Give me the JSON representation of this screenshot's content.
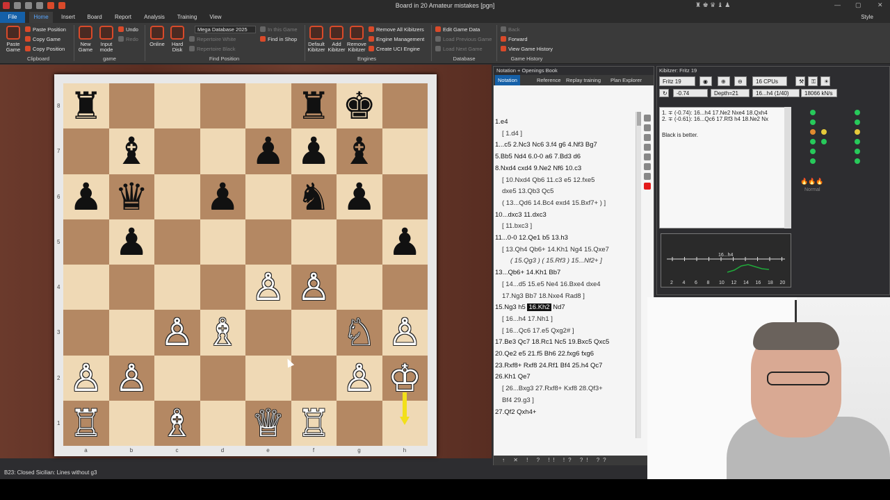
{
  "title": "Board in 20 Amateur mistakes [pgn]",
  "menu": {
    "file": "File",
    "home": "Home",
    "insert": "Insert",
    "board": "Board",
    "report": "Report",
    "analysis": "Analysis",
    "training": "Training",
    "view": "View",
    "style": "Style"
  },
  "ribbon": {
    "paste_game": "Paste Game",
    "paste_position": "Paste Position",
    "copy_game": "Copy Game",
    "copy_position": "Copy Position",
    "new_game": "New Game",
    "input_mode": "Input mode",
    "undo": "Undo",
    "redo": "Redo",
    "online": "Online",
    "hard_disk": "Hard Disk",
    "database": "Mega Database 2025",
    "in_this_game": "In this Game",
    "repertoire_white": "Repertoire White",
    "repertoire_black": "Repertoire Black",
    "find_in_shop": "Find in Shop",
    "default_kibitzer": "Default Kibitzer",
    "add_kibitzer": "Add Kibitzer",
    "remove_kibitzer": "Remove Kibitzer",
    "remove_all_kibitzers": "Remove All Kibitzers",
    "engine_management": "Engine Management",
    "create_uci_engine": "Create UCI Engine",
    "edit_game_data": "Edit Game Data",
    "load_previous_game": "Load Previous Game",
    "load_next_game": "Load Next Game",
    "back": "Back",
    "forward": "Forward",
    "view_game_history": "View Game History",
    "groups": {
      "clipboard": "Clipboard",
      "game": "game",
      "find_position": "Find Position",
      "engines": "Engines",
      "database": "Database",
      "game_history": "Game History"
    }
  },
  "board": {
    "ranks": [
      "8",
      "7",
      "6",
      "5",
      "4",
      "3",
      "2",
      "1"
    ],
    "files": [
      "a",
      "b",
      "c",
      "d",
      "e",
      "f",
      "g",
      "h"
    ],
    "pieces": [
      {
        "sq": "a8",
        "g": "♜",
        "c": "b"
      },
      {
        "sq": "f8",
        "g": "♜",
        "c": "b"
      },
      {
        "sq": "g8",
        "g": "♚",
        "c": "b"
      },
      {
        "sq": "b7",
        "g": "♝",
        "c": "b"
      },
      {
        "sq": "e7",
        "g": "♟",
        "c": "b"
      },
      {
        "sq": "f7",
        "g": "♟",
        "c": "b"
      },
      {
        "sq": "g7",
        "g": "♝",
        "c": "b"
      },
      {
        "sq": "a6",
        "g": "♟",
        "c": "b"
      },
      {
        "sq": "b6",
        "g": "♛",
        "c": "b"
      },
      {
        "sq": "d6",
        "g": "♟",
        "c": "b"
      },
      {
        "sq": "f6",
        "g": "♞",
        "c": "b"
      },
      {
        "sq": "g6",
        "g": "♟",
        "c": "b"
      },
      {
        "sq": "b5",
        "g": "♟",
        "c": "b"
      },
      {
        "sq": "h5",
        "g": "♟",
        "c": "b"
      },
      {
        "sq": "e4",
        "g": "♙",
        "c": "w"
      },
      {
        "sq": "f4",
        "g": "♙",
        "c": "w"
      },
      {
        "sq": "c3",
        "g": "♙",
        "c": "w"
      },
      {
        "sq": "d3",
        "g": "♗",
        "c": "w"
      },
      {
        "sq": "g3",
        "g": "♘",
        "c": "w"
      },
      {
        "sq": "h3",
        "g": "♙",
        "c": "w"
      },
      {
        "sq": "a2",
        "g": "♙",
        "c": "w"
      },
      {
        "sq": "b2",
        "g": "♙",
        "c": "w"
      },
      {
        "sq": "g2",
        "g": "♙",
        "c": "w"
      },
      {
        "sq": "h2",
        "g": "♔",
        "c": "w"
      },
      {
        "sq": "a1",
        "g": "♖",
        "c": "w"
      },
      {
        "sq": "c1",
        "g": "♗",
        "c": "w"
      },
      {
        "sq": "e1",
        "g": "♕",
        "c": "w"
      },
      {
        "sq": "f1",
        "g": "♖",
        "c": "w"
      }
    ],
    "arrow_color": "#f2e01a"
  },
  "notation": {
    "header": "Notation + Openings Book",
    "tabs": [
      "Notation",
      "Reference",
      "Replay training",
      "Plan Explorer"
    ],
    "lines": [
      {
        "t": "1.e4",
        "k": "main"
      },
      {
        "t": "[ 1.d4 ]",
        "k": "var"
      },
      {
        "t": "1...c5 2.Nc3 Nc6 3.f4 g6 4.Nf3 Bg7",
        "k": "main"
      },
      {
        "t": "5.Bb5 Nd4 6.0-0 a6 7.Bd3 d6",
        "k": "main"
      },
      {
        "t": "8.Nxd4 cxd4 9.Ne2 Nf6 10.c3",
        "k": "main"
      },
      {
        "t": "[ 10.Nxd4 Qb6 11.c3 e5 12.fxe5",
        "k": "var"
      },
      {
        "t": "dxe5 13.Qb3 Qc5",
        "k": "var"
      },
      {
        "t": "( 13...Qd6 14.Bc4 exd4 15.Bxf7+ ) ]",
        "k": "var"
      },
      {
        "t": "10...dxc3 11.dxc3",
        "k": "main"
      },
      {
        "t": "[ 11.bxc3 ]",
        "k": "var"
      },
      {
        "t": "11...0-0 12.Qe1 b5 13.h3",
        "k": "main"
      },
      {
        "t": "[ 13.Qh4 Qb6+ 14.Kh1 Ng4 15.Qxe7",
        "k": "var"
      },
      {
        "t": "( 15.Qg3 ) ( 15.Rf3 ) 15...Nf2+ ]",
        "k": "sub"
      },
      {
        "t": "13...Qb6+ 14.Kh1 Bb7",
        "k": "main"
      },
      {
        "t": "[ 14...d5 15.e5 Ne4 16.Bxe4 dxe4",
        "k": "var"
      },
      {
        "t": "17.Ng3 Bb7 18.Nxe4 Rad8 ]",
        "k": "var"
      },
      {
        "t": "15.Ng3 h5",
        "k": "main",
        "hl": "16.Kh2",
        "tail": "Nd7"
      },
      {
        "t": "[ 16...h4 17.Nh1 ]",
        "k": "var"
      },
      {
        "t": "[ 16...Qc6 17.e5 Qxg2# ]",
        "k": "var"
      },
      {
        "t": "17.Be3 Qc7 18.Rc1 Nc5 19.Bxc5 Qxc5",
        "k": "main"
      },
      {
        "t": "20.Qe2 e5 21.f5 Bh6 22.fxg6 fxg6",
        "k": "main"
      },
      {
        "t": "23.Rxf8+ Rxf8 24.Rf1 Bf4 25.h4 Qc7",
        "k": "main"
      },
      {
        "t": "26.Kh1 Qe7",
        "k": "main"
      },
      {
        "t": "[ 26...Bxg3 27.Rxf8+ Kxf8 28.Qf3+",
        "k": "var"
      },
      {
        "t": "Bf4 29.g3 ]",
        "k": "var"
      },
      {
        "t": "27.Qf2 Qxh4+",
        "k": "main"
      }
    ],
    "bottom": "↑ ✕ ! ? !! !? ?! ??"
  },
  "kibitzer": {
    "header": "Kibitzer: Fritz 19",
    "engine": "Fritz 19",
    "cpus": "16 CPUs",
    "eval": "-0.74",
    "depth": "Depth=21",
    "move": "16...h4 (1/40)",
    "speed": "18066 kN/s",
    "line1": "1. ∓ (-0.74):     16...h4 17.Ne2 Nxe4 18.Qxh4",
    "line2": "2. ∓ (-0.61):     16...Qc6 17.Rf3 h4 18.Ne2 Nx",
    "assessment": "Black is better.",
    "graph_label": "16...h4",
    "graph_ticks": [
      "2",
      "4",
      "6",
      "8",
      "10",
      "12",
      "14",
      "16",
      "18",
      "20"
    ],
    "normal": "Normal"
  },
  "status": "B23: Closed Sicilian: Lines without g3"
}
